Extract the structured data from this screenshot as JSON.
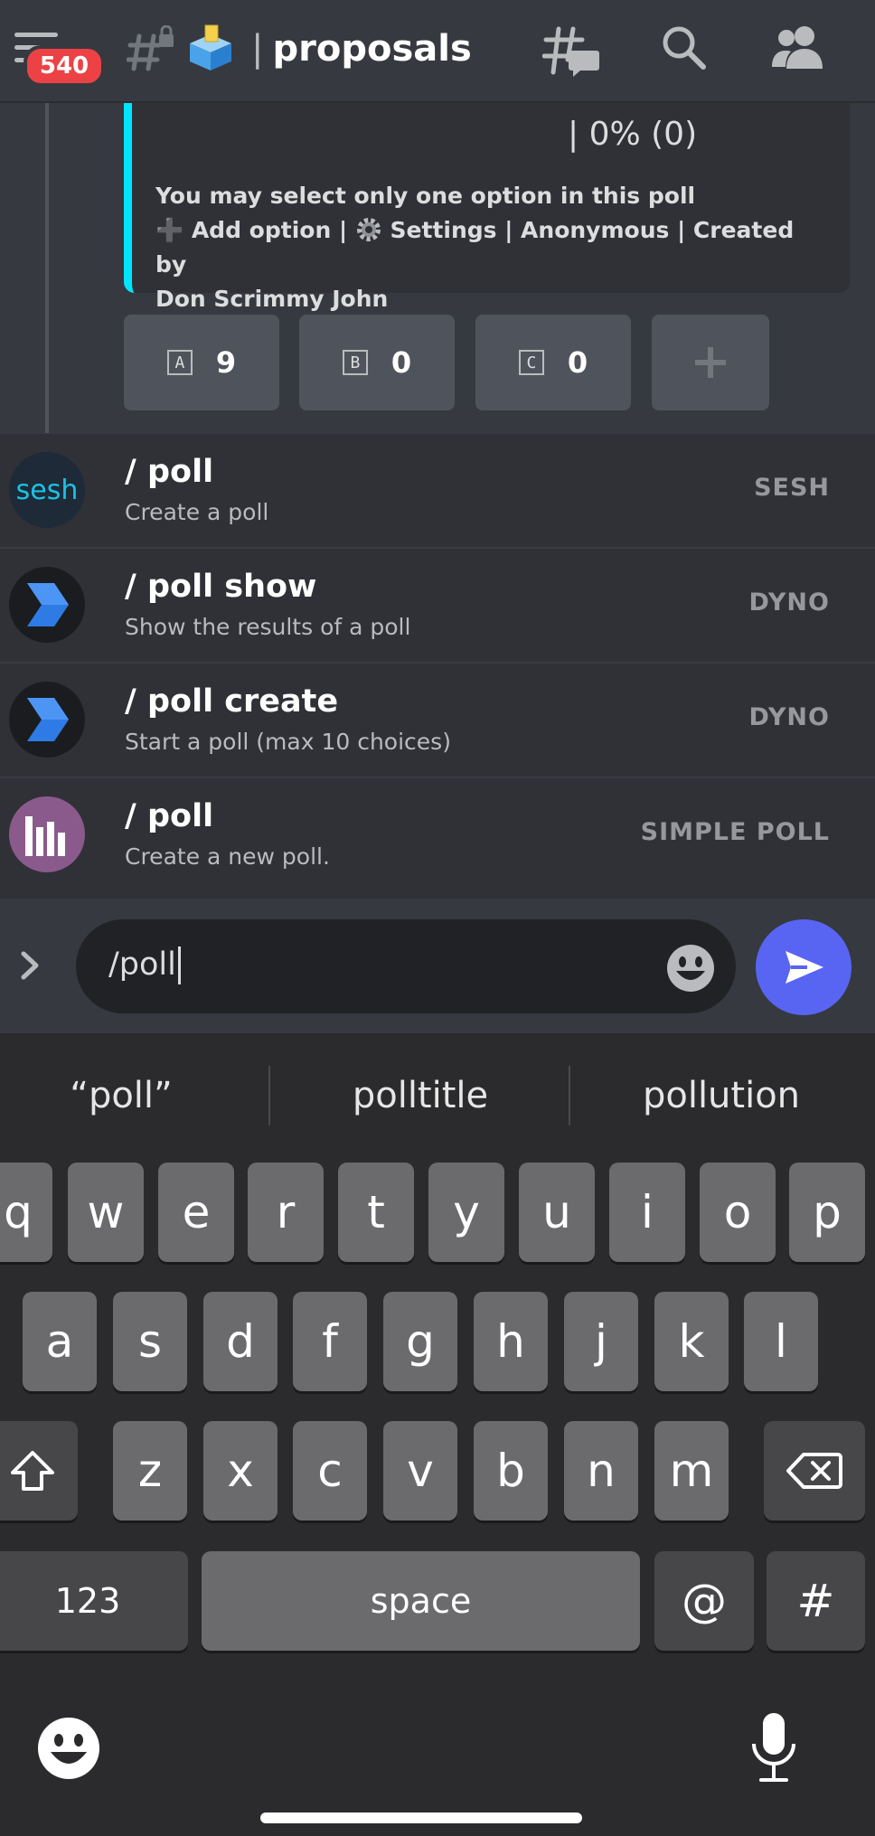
{
  "header": {
    "badge_count": "540",
    "channel_name": "proposals",
    "channel_emoji": "ballot-box",
    "icons": [
      "menu-icon",
      "locked-hash-icon",
      "threads-icon",
      "search-icon",
      "members-icon"
    ]
  },
  "poll_embed": {
    "result_text": "| 0% (0)",
    "instruction": "You may select only one option in this poll",
    "add_option": "➕ Add option |",
    "settings": "Settings | Anonymous | Created by",
    "creator": "Don Scrimmy John",
    "buttons": [
      {
        "letter": "A",
        "count": "9"
      },
      {
        "letter": "B",
        "count": "0"
      },
      {
        "letter": "C",
        "count": "0"
      }
    ],
    "accent_color": "#00e5ff"
  },
  "autocomplete": [
    {
      "command": "/ poll",
      "description": "Create a poll",
      "app": "SESH",
      "avatar_text": "sesh"
    },
    {
      "command": "/ poll show",
      "description": "Show the results of a poll",
      "app": "DYNO"
    },
    {
      "command": "/ poll create",
      "description": "Start a poll (max 10 choices)",
      "app": "DYNO"
    },
    {
      "command": "/ poll",
      "description": "Create a new poll.",
      "app": "SIMPLE POLL"
    }
  ],
  "composer": {
    "value": "/poll",
    "send_color": "#5865f2"
  },
  "keyboard": {
    "suggestions": [
      "“poll”",
      "polltitle",
      "pollution"
    ],
    "row1": [
      "q",
      "w",
      "e",
      "r",
      "t",
      "y",
      "u",
      "i",
      "o",
      "p"
    ],
    "row2": [
      "a",
      "s",
      "d",
      "f",
      "g",
      "h",
      "j",
      "k",
      "l"
    ],
    "row3": [
      "z",
      "x",
      "c",
      "v",
      "b",
      "n",
      "m"
    ],
    "numbers_key": "123",
    "space_key": "space",
    "at_key": "@",
    "hash_key": "#"
  }
}
